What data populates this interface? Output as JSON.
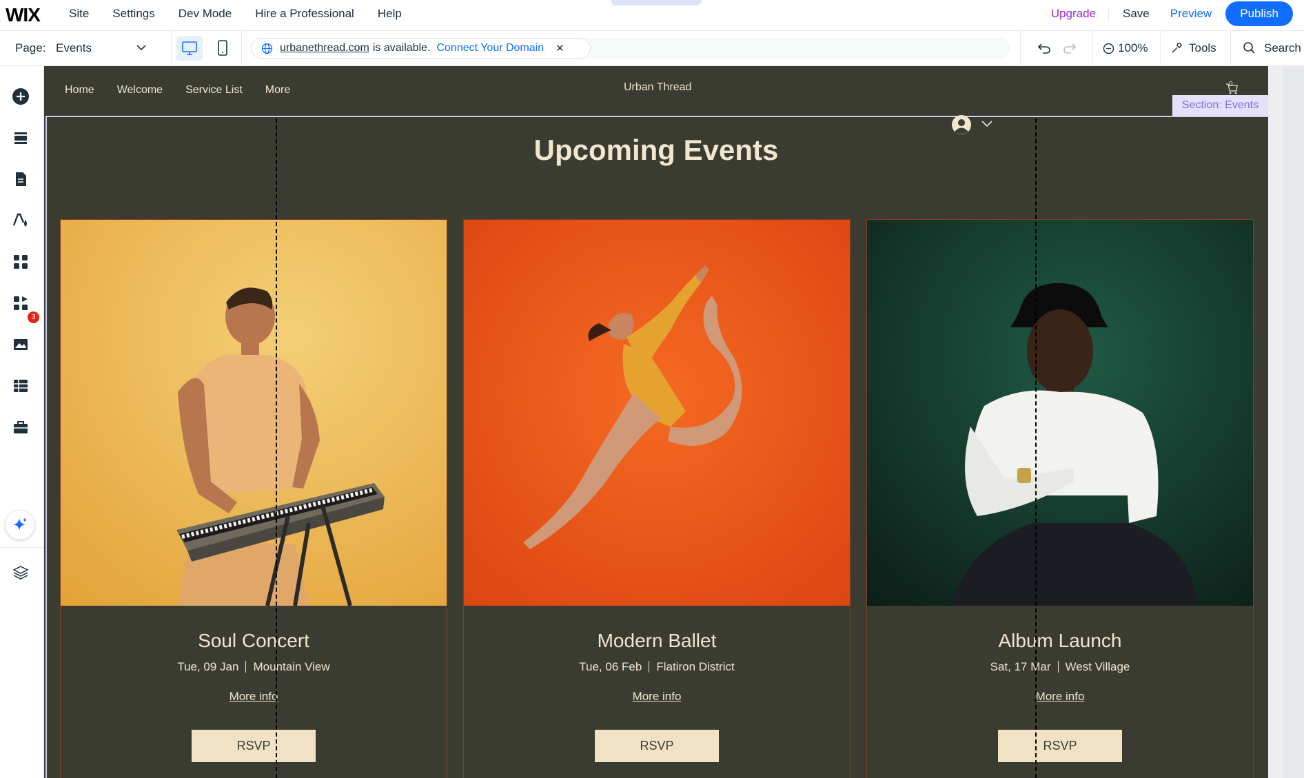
{
  "editor": {
    "logo": "WIX",
    "menu": [
      "Site",
      "Settings",
      "Dev Mode",
      "Hire a Professional",
      "Help"
    ],
    "upgrade": "Upgrade",
    "save": "Save",
    "preview": "Preview",
    "publish": "Publish",
    "page_label": "Page:",
    "page_value": "Events",
    "domain": "urbanethread.com",
    "domain_available": "is available.",
    "connect_domain": "Connect Your Domain",
    "zoom": "100%",
    "tools": "Tools",
    "search": "Search",
    "apps_badge": "3",
    "section_tag": "Section: Events"
  },
  "site": {
    "nav": [
      "Home",
      "Welcome",
      "Service List",
      "More"
    ],
    "brand": "Urban Thread",
    "cart_count": "0",
    "title": "Upcoming Events",
    "events": [
      {
        "name": "Soul Concert",
        "date": "Tue, 09 Jan",
        "location": "Mountain View",
        "more": "More info",
        "rsvp": "RSVP"
      },
      {
        "name": "Modern Ballet",
        "date": "Tue, 06 Feb",
        "location": "Flatiron District",
        "more": "More info",
        "rsvp": "RSVP"
      },
      {
        "name": "Album Launch",
        "date": "Sat, 17 Mar",
        "location": "West Village",
        "more": "More info",
        "rsvp": "RSVP"
      }
    ]
  },
  "colors": {
    "site_bg": "#3a3c31",
    "cream": "#f1e6cf",
    "accent_blue": "#116dff",
    "upgrade_purple": "#9a27d5"
  }
}
